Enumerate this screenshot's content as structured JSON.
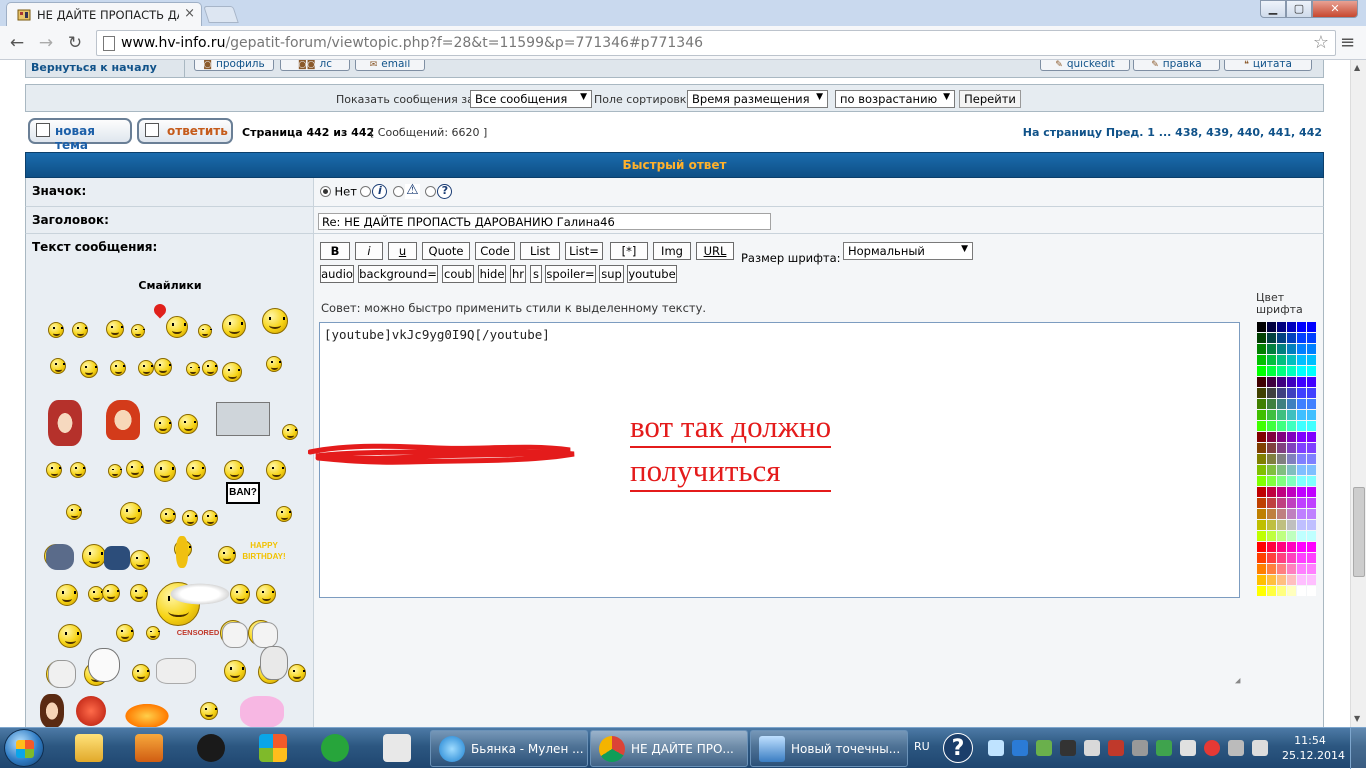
{
  "browser": {
    "tab_title": "НЕ ДАЙТЕ ПРОПАСТЬ ДА",
    "url_host": "www.hv-info.ru",
    "url_path": "/gepatit-forum/viewtopic.php?f=28&t=11599&p=771346#p771346",
    "window_controls": [
      "minimize",
      "maximize",
      "close"
    ]
  },
  "forum": {
    "back_to_top": "Вернуться к началу",
    "post_buttons": [
      "профиль",
      "лс",
      "email"
    ],
    "post_actions": [
      "quickedit",
      "правка",
      "цитата"
    ],
    "sort": {
      "show_label": "Показать сообщения за:",
      "show_value": "Все сообщения",
      "sort_label": "Поле сортировки",
      "sort_value": "Время размещения",
      "order_value": "по возрастанию",
      "go_label": "Перейти"
    },
    "new_topic_label": "новая тема",
    "reply_label": "ответить",
    "page_info": "Страница 442 из 442",
    "message_count": "[ Сообщений: 6620 ]",
    "pagination": "На страницу Пред.  1 ... 438, 439, 440, 441, 442"
  },
  "quick_reply": {
    "title": "Быстрый ответ",
    "icon_label": "Значок:",
    "icon_none": "Нет",
    "subject_label": "Заголовок:",
    "subject_value": "Re: НЕ ДАЙТЕ ПРОПАСТЬ ДАРОВАНИЮ Галина46",
    "message_label": "Текст сообщения:",
    "smilies_title": "Смайлики",
    "format_row1": [
      "B",
      "i",
      "u",
      "Quote",
      "Code",
      "List",
      "List=",
      "[*]",
      "Img",
      "URL"
    ],
    "format_row2": [
      "audio",
      "background=",
      "coub",
      "hide",
      "hr",
      "s",
      "spoiler=",
      "sup",
      "youtube"
    ],
    "font_size_label": "Размер шрифта:",
    "font_size_value": "Нормальный",
    "tip": "Совет: можно быстро применить стили к выделенному тексту.",
    "message_text": "[youtube]vkJc9yg0I9Q[/youtube]",
    "annotation_line1": "вот так должно ",
    "annotation_line2": "получиться",
    "color_title_1": "Цвет",
    "color_title_2": "шрифта",
    "banner_text": "BAN?",
    "happy_birthday_1": "HAPPY",
    "happy_birthday_2": "BIRTHDAY!",
    "censored_text": "CENSORED"
  },
  "colors": {
    "link": "#105289",
    "header_bar": "#0e4f85",
    "header_text": "#ffb12b",
    "annotation": "#e41b1b"
  },
  "taskbar": {
    "tasks": [
      {
        "label": "Бьянка - Мулен ...",
        "icon": "internet-explorer-icon"
      },
      {
        "label": "НЕ ДАЙТЕ ПРО...",
        "icon": "chrome-icon"
      },
      {
        "label": "Новый точечны...",
        "icon": "paint-icon"
      }
    ],
    "language": "RU",
    "time": "11:54",
    "date": "25.12.2014"
  }
}
